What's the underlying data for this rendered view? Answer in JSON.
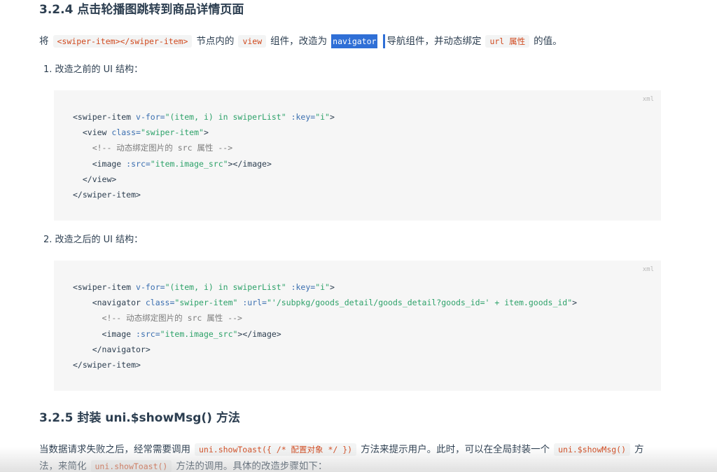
{
  "section1": {
    "title": "3.2.4 点击轮播图跳转到商品详情页面",
    "intro": {
      "t1": "将",
      "c1": "<swiper-item></swiper-item>",
      "t2": "节点内的",
      "c2": "view",
      "t3": "组件，改造为",
      "c3": "navigator",
      "t4": "导航组件，并动态绑定",
      "c4": "url 属性",
      "t5": "的值。"
    },
    "step1": "1. 改造之前的 UI 结构：",
    "step2": "2. 改造之后的 UI 结构：",
    "code1": {
      "lang": "xml",
      "l1": {
        "a": "<swiper-item ",
        "b": "v-for=",
        "c": "\"(item, i) in swiperList\"",
        "d": " :key=",
        "e": "\"i\"",
        "f": ">"
      },
      "l2": {
        "a": "  <view ",
        "b": "class=",
        "c": "\"swiper-item\"",
        "d": ">"
      },
      "l3": "    <!-- 动态绑定图片的 src 属性 -->",
      "l4": {
        "a": "    <image ",
        "b": ":src=",
        "c": "\"item.image_src\"",
        "d": "></image>"
      },
      "l5": "  </view>",
      "l6": "</swiper-item>"
    },
    "code2": {
      "lang": "xml",
      "l1": {
        "a": "<swiper-item ",
        "b": "v-for=",
        "c": "\"(item, i) in swiperList\"",
        "d": " :key=",
        "e": "\"i\"",
        "f": ">"
      },
      "l2": {
        "a": "    <navigator ",
        "b": "class=",
        "c": "\"swiper-item\"",
        "d": " :url=",
        "e": "\"'/subpkg/goods_detail/goods_detail?goods_id=' + item.goods_id\"",
        "f": ">"
      },
      "l3": "      <!-- 动态绑定图片的 src 属性 -->",
      "l4": {
        "a": "      <image ",
        "b": ":src=",
        "c": "\"item.image_src\"",
        "d": "></image>"
      },
      "l5": "    </navigator>",
      "l6": "</swiper-item>"
    }
  },
  "section2": {
    "title": "3.2.5 封装 uni.$showMsg() 方法",
    "p1": {
      "t1": "当数据请求失败之后，经常需要调用",
      "c1": "uni.showToast({ /* 配置对象 */ })",
      "t2": "方法来提示用户。此时，可以在全局封装一个",
      "c2": "uni.$showMsg()",
      "t3": "方"
    },
    "p2": {
      "t1": "法，来简化",
      "c1": "uni.showToast()",
      "t2": "方法的调用。具体的改造步骤如下："
    }
  }
}
